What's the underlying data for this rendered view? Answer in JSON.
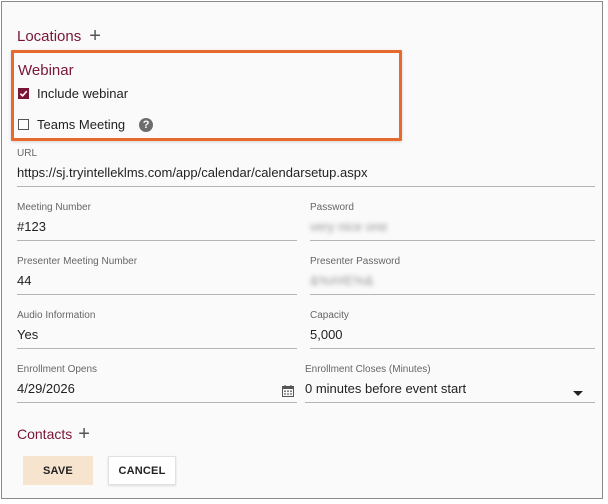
{
  "locations": {
    "title": "Locations",
    "add_icon": "plus-icon"
  },
  "webinar": {
    "title": "Webinar",
    "include_label": "Include webinar",
    "include_checked": true,
    "teams_label": "Teams Meeting",
    "teams_checked": false,
    "help_glyph": "?"
  },
  "fields": {
    "url": {
      "label": "URL",
      "value": "https://sj.tryintelleklms.com/app/calendar/calendarsetup.aspx"
    },
    "meeting_number": {
      "label": "Meeting Number",
      "value": "#123"
    },
    "password": {
      "label": "Password",
      "value": "very nice one"
    },
    "presenter_meeting_number": {
      "label": "Presenter Meeting Number",
      "value": "44"
    },
    "presenter_password": {
      "label": "Presenter Password",
      "value": "&%##E%&"
    },
    "audio_information": {
      "label": "Audio Information",
      "value": "Yes"
    },
    "capacity": {
      "label": "Capacity",
      "value": "5,000"
    },
    "enrollment_opens": {
      "label": "Enrollment Opens",
      "value": "4/29/2026"
    },
    "enrollment_closes": {
      "label": "Enrollment Closes (Minutes)",
      "value": "0 minutes before event start"
    }
  },
  "contacts": {
    "title": "Contacts",
    "add_icon": "plus-icon"
  },
  "actions": {
    "save_label": "SAVE",
    "cancel_label": "CANCEL"
  },
  "colors": {
    "accent": "#7a1538",
    "highlight": "#e8692e",
    "save_bg": "#f7e4cf"
  }
}
